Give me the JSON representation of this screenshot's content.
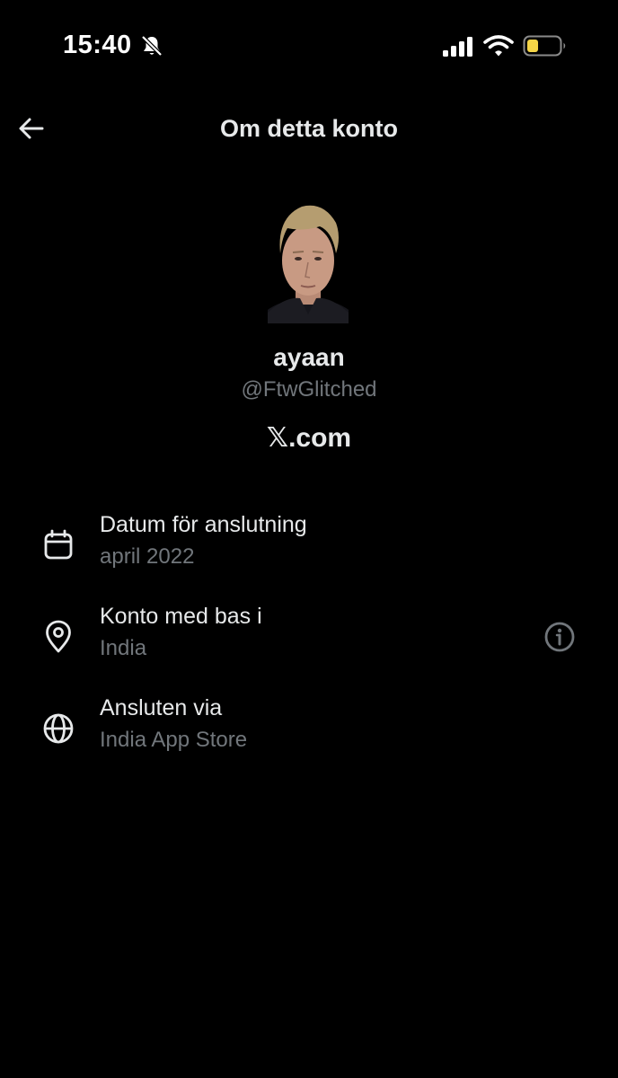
{
  "status_bar": {
    "time": "15:40"
  },
  "header": {
    "title": "Om detta konto"
  },
  "profile": {
    "display_name": "ayaan",
    "handle": "@FtwGlitched",
    "brand_symbol": "𝕏",
    "brand_suffix": ".com"
  },
  "details": [
    {
      "title": "Datum för anslutning",
      "value": "april 2022",
      "icon": "calendar-icon"
    },
    {
      "title": "Konto med bas i",
      "value": "India",
      "icon": "location-pin-icon"
    },
    {
      "title": "Ansluten via",
      "value": "India App Store",
      "icon": "globe-icon"
    }
  ],
  "colors": {
    "background": "#000000",
    "primary_text": "#e7e9ea",
    "secondary_text": "#71767b",
    "battery_fill": "#f5d547"
  }
}
